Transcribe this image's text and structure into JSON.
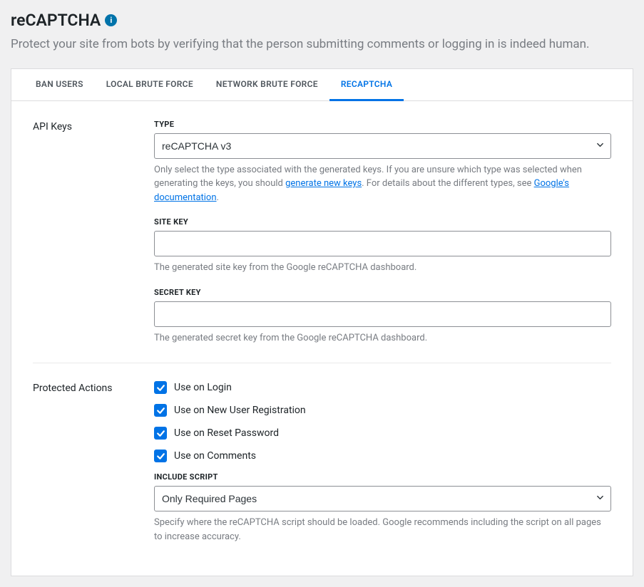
{
  "header": {
    "title": "reCAPTCHA",
    "subtitle": "Protect your site from bots by verifying that the person submitting comments or logging in is indeed human."
  },
  "tabs": [
    {
      "label": "BAN USERS",
      "active": false
    },
    {
      "label": "LOCAL BRUTE FORCE",
      "active": false
    },
    {
      "label": "NETWORK BRUTE FORCE",
      "active": false
    },
    {
      "label": "RECAPTCHA",
      "active": true
    }
  ],
  "apiKeys": {
    "sectionLabel": "API Keys",
    "typeLabel": "TYPE",
    "typeValue": "reCAPTCHA v3",
    "typeHelper1": "Only select the type associated with the generated keys. If you are unsure which type was selected when generating the keys, you should ",
    "typeHelperLink1": "generate new keys",
    "typeHelper2": ". For details about the different types, see ",
    "typeHelperLink2": "Google's documentation",
    "typeHelper3": ".",
    "siteKeyLabel": "SITE KEY",
    "siteKeyValue": "",
    "siteKeyHelper": "The generated site key from the Google reCAPTCHA dashboard.",
    "secretKeyLabel": "SECRET KEY",
    "secretKeyValue": "",
    "secretKeyHelper": "The generated secret key from the Google reCAPTCHA dashboard."
  },
  "protectedActions": {
    "sectionLabel": "Protected Actions",
    "checkboxes": [
      {
        "label": "Use on Login",
        "checked": true
      },
      {
        "label": "Use on New User Registration",
        "checked": true
      },
      {
        "label": "Use on Reset Password",
        "checked": true
      },
      {
        "label": "Use on Comments",
        "checked": true
      }
    ],
    "includeScriptLabel": "INCLUDE SCRIPT",
    "includeScriptValue": "Only Required Pages",
    "includeScriptHelper": "Specify where the reCAPTCHA script should be loaded. Google recommends including the script on all pages to increase accuracy."
  }
}
